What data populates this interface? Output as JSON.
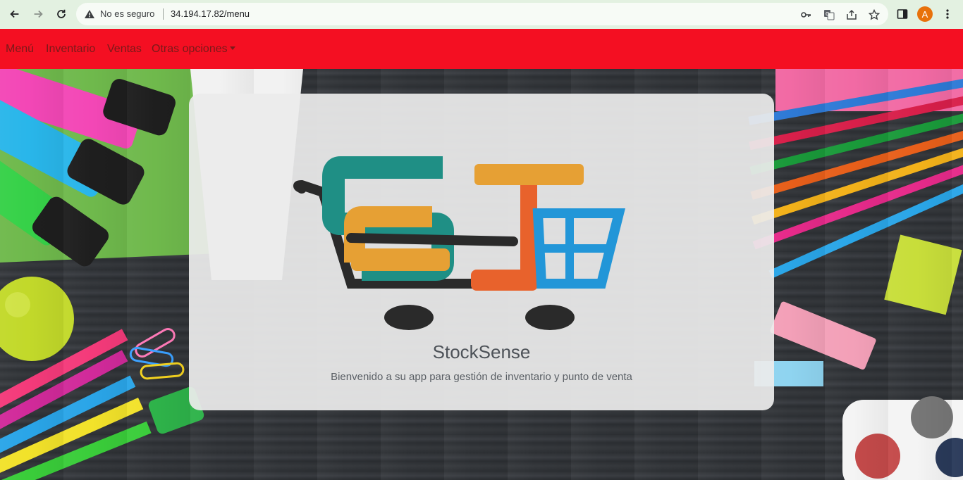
{
  "browser": {
    "security_label": "No es seguro",
    "url": "34.194.17.82/menu",
    "profile_initial": "A"
  },
  "nav": {
    "items": [
      {
        "label": "Menú"
      },
      {
        "label": "Inventario"
      },
      {
        "label": "Ventas"
      },
      {
        "label": "Otras opciones"
      }
    ]
  },
  "card": {
    "title": "StockSense",
    "subtitle": "Bienvenido a su app para gestión de inventario y punto de venta"
  },
  "colors": {
    "navbar": "#f40f22",
    "logo_teal": "#1f8f85",
    "logo_orange": "#e6a034",
    "logo_red": "#e8622c",
    "logo_blue": "#2296d8",
    "logo_dark": "#2a2a2a"
  }
}
